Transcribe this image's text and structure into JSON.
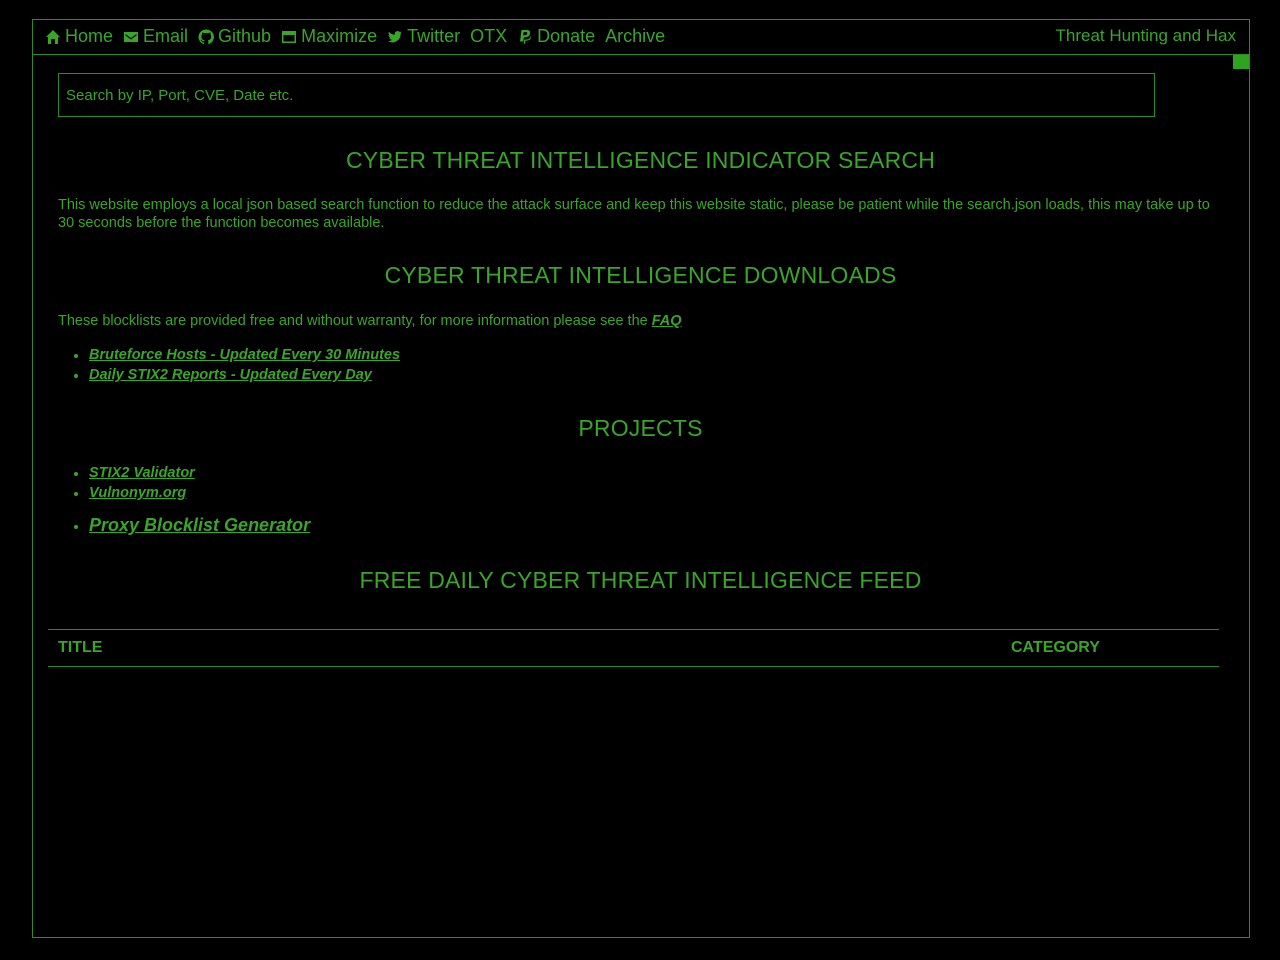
{
  "nav": {
    "items": [
      {
        "label": "Home",
        "icon": "home-icon"
      },
      {
        "label": "Email",
        "icon": "envelope-icon"
      },
      {
        "label": "Github",
        "icon": "github-icon"
      },
      {
        "label": "Maximize",
        "icon": "window-maximize-icon"
      },
      {
        "label": "Twitter",
        "icon": "twitter-icon"
      },
      {
        "label": "OTX",
        "icon": ""
      },
      {
        "label": "Donate",
        "icon": "paypal-icon"
      },
      {
        "label": "Archive",
        "icon": ""
      }
    ],
    "brand": "Threat Hunting and Hax"
  },
  "search": {
    "placeholder": "Search by IP, Port, CVE, Date etc."
  },
  "sections": {
    "indicator_title": "CYBER THREAT INTELLIGENCE INDICATOR SEARCH",
    "indicator_text": "This website employs a local json based search function to reduce the attack surface and keep this website static, please be patient while the search.json loads, this may take up to 30 seconds before the function becomes available.",
    "downloads_title": "CYBER THREAT INTELLIGENCE DOWNLOADS",
    "downloads_text": "These blocklists are provided free and without warranty, for more information please see the",
    "downloads_faq": "FAQ",
    "downloads": [
      "Bruteforce Hosts - Updated Every 30 Minutes",
      "Daily STIX2 Reports - Updated Every Day"
    ],
    "projects_title": "PROJECTS",
    "projects": [
      "STIX2 Validator",
      "Vulnonym.org",
      "Proxy Blocklist Generator"
    ],
    "feed_title": "FREE DAILY CYBER THREAT INTELLIGENCE FEED"
  },
  "table": {
    "col_title": "TITLE",
    "col_category": "CATEGORY"
  },
  "colors": {
    "background": "#000000",
    "accent": "#3aa52a",
    "border": "#2e8b22"
  }
}
